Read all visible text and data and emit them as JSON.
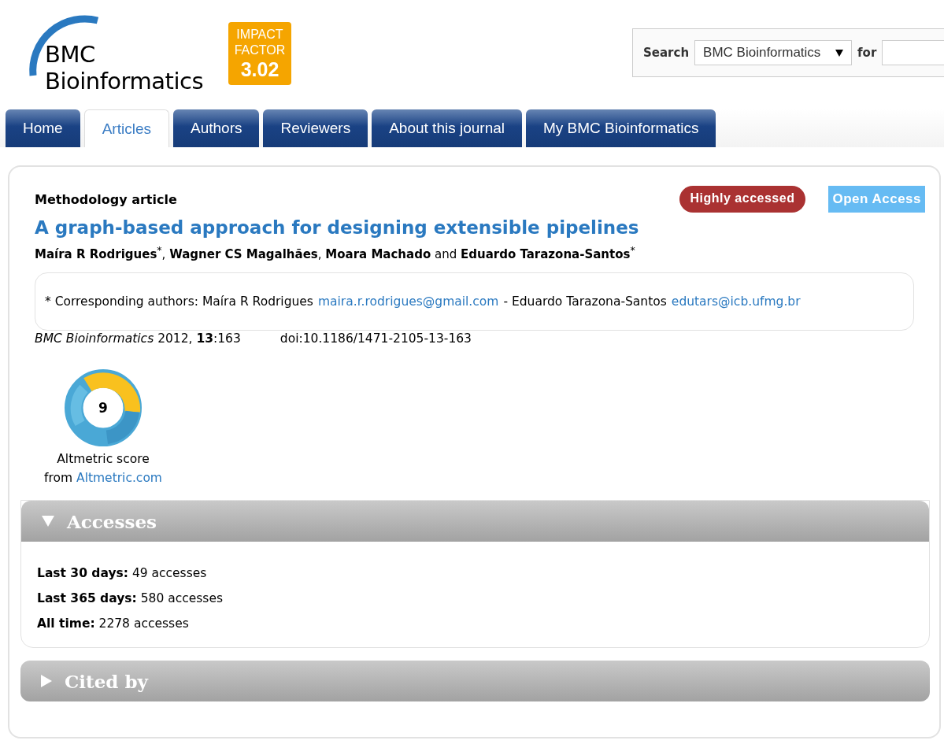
{
  "header": {
    "logo": {
      "line_1": "BMC",
      "line_2": "Bioinformatics"
    },
    "impact_factor": {
      "label_1": "IMPACT",
      "label_2": "FACTOR",
      "value": "3.02"
    },
    "search": {
      "label": "Search",
      "scope": "BMC Bioinformatics",
      "for_label": "for"
    }
  },
  "tabs": [
    {
      "label": "Home",
      "selected": false
    },
    {
      "label": "Articles",
      "selected": true
    },
    {
      "label": "Authors",
      "selected": false
    },
    {
      "label": "Reviewers",
      "selected": false
    },
    {
      "label": "About this journal",
      "selected": false
    },
    {
      "label": "My BMC Bioinformatics",
      "selected": false
    }
  ],
  "article": {
    "type": "Methodology article",
    "badges": [
      {
        "label": "Highly accessed",
        "kind": "pill"
      },
      {
        "label": "Open Access",
        "kind": "flag"
      }
    ],
    "title": "A graph-based approach for designing extensible pipelines",
    "authors": "**Maíra R Rodrigues**$^{*}$, **Wagner CS Magalhães**, **Moara Machado** and **Eduardo Tarazona-Santos**$^{*}$",
    "correspondence": [
      {
        "kind": "text",
        "text": "*  Corresponding authors: Maíra R Rodrigues"
      },
      {
        "kind": "link",
        "text": "maira.r.rodrigues@gmail.com"
      },
      {
        "kind": "text",
        "text": "- Eduardo Tarazona-Santos"
      },
      {
        "kind": "link",
        "text": "edutars@icb.ufmg.br"
      }
    ],
    "citation": "*BMC Bioinformatics* 2012, **13**:163",
    "doi": "doi:10.1186/1471-2105-13-163"
  },
  "altmetric": {
    "score": "9",
    "caption": "Altmetric score",
    "from": "from",
    "link": "Altmetric.com"
  },
  "sections": [
    {
      "title": "Accesses",
      "expanded": true,
      "rows": [
        "**Last 30 days:** 49 accesses",
        "**Last 365 days:** 580 accesses",
        "**All time:** 2278 accesses"
      ]
    },
    {
      "title": "Cited by",
      "expanded": false
    }
  ]
}
